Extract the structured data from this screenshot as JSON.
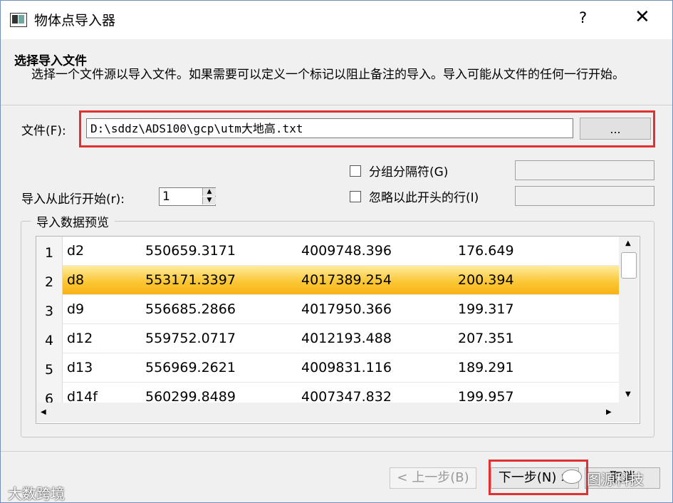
{
  "window": {
    "title": "物体点导入器",
    "help": "?",
    "close": "✕"
  },
  "header": {
    "title": "选择导入文件",
    "description": "选择一个文件源以导入文件。如果需要可以定义一个标记以阻止备注的导入。导入可能从文件的任何一行开始。"
  },
  "file": {
    "label": "文件(F):",
    "value": "D:\\sddz\\ADS100\\gcp\\utm大地高.txt",
    "browse_label": "..."
  },
  "options": {
    "group_separator_label": "分组分隔符(G)",
    "ignore_lines_label": "忽略以此开头的行(I)",
    "start_row_label": "导入从此行开始(r):",
    "start_row_value": "1"
  },
  "preview": {
    "title": "导入数据预览",
    "rows": [
      {
        "num": "1",
        "cells": [
          "d2",
          "550659.3171",
          "4009748.396",
          "176.649"
        ],
        "selected": false
      },
      {
        "num": "2",
        "cells": [
          "d8",
          "553171.3397",
          "4017389.254",
          "200.394"
        ],
        "selected": true
      },
      {
        "num": "3",
        "cells": [
          "d9",
          "556685.2866",
          "4017950.366",
          "199.317"
        ],
        "selected": false
      },
      {
        "num": "4",
        "cells": [
          "d12",
          "559752.0717",
          "4012193.488",
          "207.351"
        ],
        "selected": false
      },
      {
        "num": "5",
        "cells": [
          "d13",
          "556969.2621",
          "4009831.116",
          "189.291"
        ],
        "selected": false
      },
      {
        "num": "6",
        "cells": [
          "d14f",
          "560299.8489",
          "4007347.832",
          "199.957"
        ],
        "selected": false
      }
    ]
  },
  "buttons": {
    "back": "< 上一步(B)",
    "next": "下一步(N) >",
    "cancel": "取消"
  },
  "watermarks": {
    "left": "大数跨境",
    "right": "图源科技"
  },
  "colors": {
    "highlight": "#e03030",
    "selection": "#fbc838"
  }
}
